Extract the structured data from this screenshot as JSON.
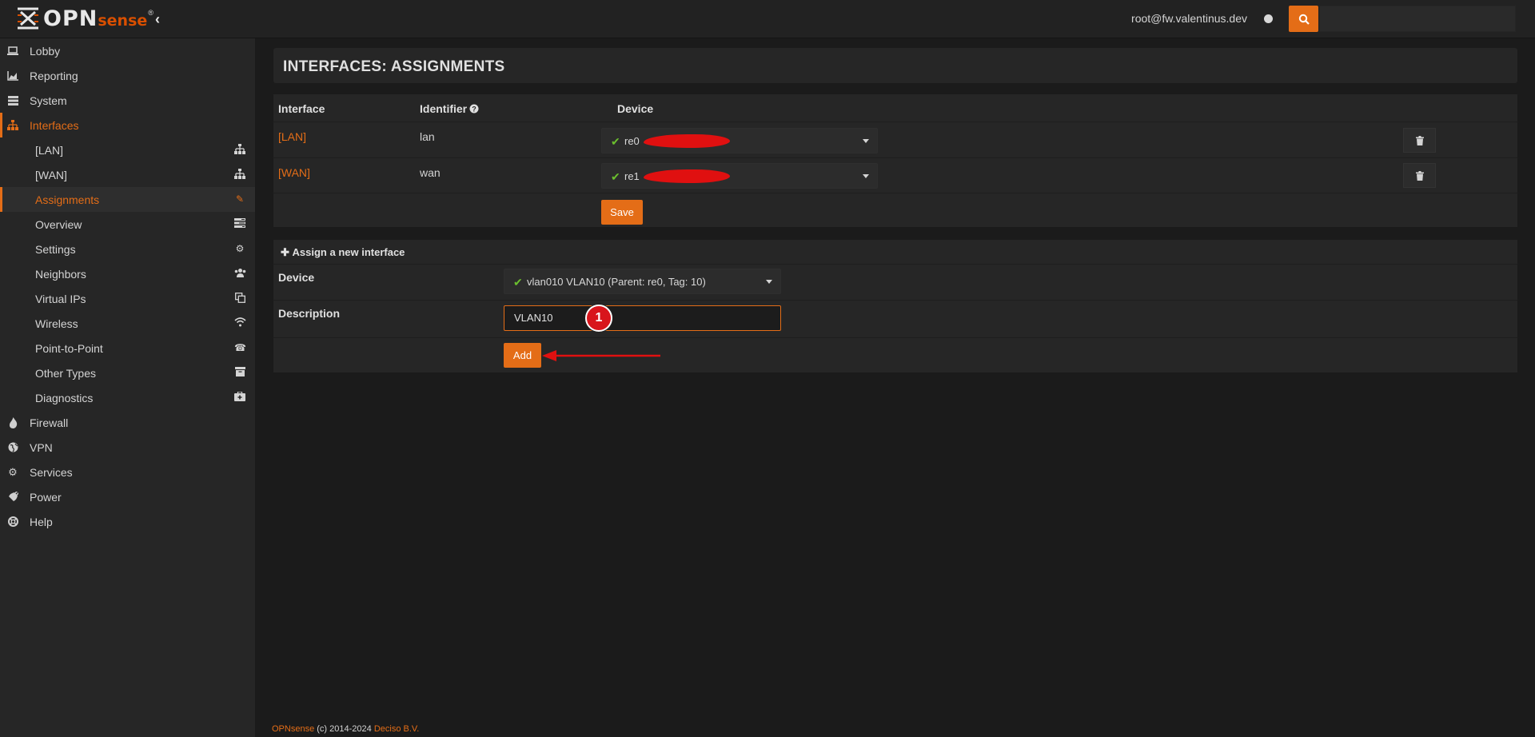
{
  "app": {
    "logo_main": "OPN",
    "logo_sub": "sense",
    "logo_reg": "®",
    "user": "root@fw.valentinus.dev"
  },
  "sidebar": {
    "items": [
      {
        "label": "Lobby",
        "icon": "laptop-icon"
      },
      {
        "label": "Reporting",
        "icon": "area-chart-icon"
      },
      {
        "label": "System",
        "icon": "server-icon"
      },
      {
        "label": "Interfaces",
        "icon": "sitemap-icon",
        "active": true
      }
    ],
    "subitems": [
      {
        "label": "[LAN]",
        "icon": "sitemap-icon"
      },
      {
        "label": "[WAN]",
        "icon": "sitemap-icon"
      },
      {
        "label": "Assignments",
        "icon": "pencil-icon",
        "active": true
      },
      {
        "label": "Overview",
        "icon": "tasks-icon"
      },
      {
        "label": "Settings",
        "icon": "cogs-icon"
      },
      {
        "label": "Neighbors",
        "icon": "users-icon"
      },
      {
        "label": "Virtual IPs",
        "icon": "clone-icon"
      },
      {
        "label": "Wireless",
        "icon": "wifi-icon"
      },
      {
        "label": "Point-to-Point",
        "icon": "phone-icon"
      },
      {
        "label": "Other Types",
        "icon": "archive-icon"
      },
      {
        "label": "Diagnostics",
        "icon": "medkit-icon"
      }
    ],
    "items_after": [
      {
        "label": "Firewall",
        "icon": "fire-icon"
      },
      {
        "label": "VPN",
        "icon": "globe-icon"
      },
      {
        "label": "Services",
        "icon": "cog-icon"
      },
      {
        "label": "Power",
        "icon": "plug-icon"
      },
      {
        "label": "Help",
        "icon": "life-ring-icon"
      }
    ]
  },
  "page": {
    "title": "INTERFACES: ASSIGNMENTS"
  },
  "table": {
    "headers": {
      "interface": "Interface",
      "identifier": "Identifier",
      "device": "Device"
    },
    "rows": [
      {
        "interface": "[LAN]",
        "identifier": "lan",
        "device": "re0"
      },
      {
        "interface": "[WAN]",
        "identifier": "wan",
        "device": "re1"
      }
    ],
    "save_label": "Save"
  },
  "new_interface": {
    "header": "Assign a new interface",
    "device_label": "Device",
    "device_value": "vlan010 VLAN10 (Parent: re0, Tag: 10)",
    "description_label": "Description",
    "description_value": "VLAN10",
    "add_label": "Add",
    "callout": "1"
  },
  "footer": {
    "brand": "OPNsense",
    "copyright": "(c) 2014-2024",
    "company": "Deciso B.V."
  },
  "colors": {
    "accent": "#e46d17",
    "callout": "#d8151c",
    "plug": "#6bbf2e"
  }
}
